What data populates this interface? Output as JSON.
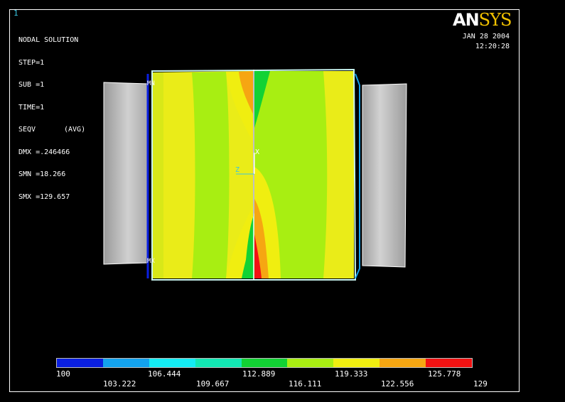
{
  "window_number": "1",
  "title": "NODAL SOLUTION",
  "info": [
    {
      "key": "STEP=1",
      "value": ""
    },
    {
      "key": "SUB =1",
      "value": ""
    },
    {
      "key": "TIME=1",
      "value": ""
    },
    {
      "key": "SEQV",
      "value": "(AVG)"
    },
    {
      "key": "DMX =.246466",
      "value": ""
    },
    {
      "key": "SMN =18.266",
      "value": ""
    },
    {
      "key": "SMX =129.657",
      "value": ""
    }
  ],
  "logo": {
    "an": "AN",
    "sys": "SYS"
  },
  "date": "JAN 28 2004",
  "time": "12:20:28",
  "markers": {
    "mn": "MN",
    "mx": "MX",
    "axis_x": "X",
    "axis_z": "Z"
  },
  "legend": {
    "colors": [
      "#0a1fe0",
      "#13a2ee",
      "#14ecf4",
      "#12e8b4",
      "#12d234",
      "#a8ee12",
      "#f0ee10",
      "#f6a612",
      "#f21212"
    ],
    "labels_top": [
      "100",
      "106.444",
      "112.889",
      "119.333",
      "125.778"
    ],
    "labels_bottom": [
      "103.222",
      "109.667",
      "116.111",
      "122.556",
      "129"
    ]
  }
}
